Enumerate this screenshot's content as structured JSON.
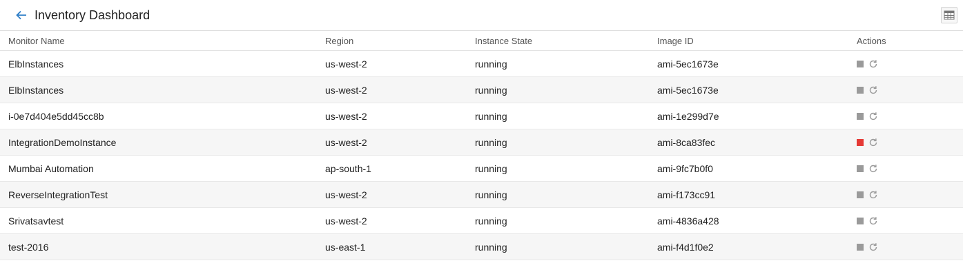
{
  "header": {
    "title": "Inventory Dashboard"
  },
  "columns": [
    "Monitor Name",
    "Region",
    "Instance State",
    "Image ID",
    "Actions"
  ],
  "rows": [
    {
      "name": "ElbInstances",
      "region": "us-west-2",
      "state": "running",
      "image": "ami-5ec1673e",
      "stop_color": "#9a9a9a"
    },
    {
      "name": "ElbInstances",
      "region": "us-west-2",
      "state": "running",
      "image": "ami-5ec1673e",
      "stop_color": "#9a9a9a"
    },
    {
      "name": "i-0e7d404e5dd45cc8b",
      "region": "us-west-2",
      "state": "running",
      "image": "ami-1e299d7e",
      "stop_color": "#9a9a9a"
    },
    {
      "name": "IntegrationDemoInstance",
      "region": "us-west-2",
      "state": "running",
      "image": "ami-8ca83fec",
      "stop_color": "#e53935"
    },
    {
      "name": "Mumbai Automation",
      "region": "ap-south-1",
      "state": "running",
      "image": "ami-9fc7b0f0",
      "stop_color": "#9a9a9a"
    },
    {
      "name": "ReverseIntegrationTest",
      "region": "us-west-2",
      "state": "running",
      "image": "ami-f173cc91",
      "stop_color": "#9a9a9a"
    },
    {
      "name": "Srivatsavtest",
      "region": "us-west-2",
      "state": "running",
      "image": "ami-4836a428",
      "stop_color": "#9a9a9a"
    },
    {
      "name": "test-2016",
      "region": "us-east-1",
      "state": "running",
      "image": "ami-f4d1f0e2",
      "stop_color": "#9a9a9a"
    }
  ],
  "colors": {
    "accent": "#2f7fc8",
    "stop_default": "#9a9a9a",
    "stop_active": "#e53935"
  },
  "icons": {
    "back": "arrow-left-icon",
    "toggle": "column-chooser-icon",
    "stop": "stop-icon",
    "refresh": "refresh-icon"
  }
}
